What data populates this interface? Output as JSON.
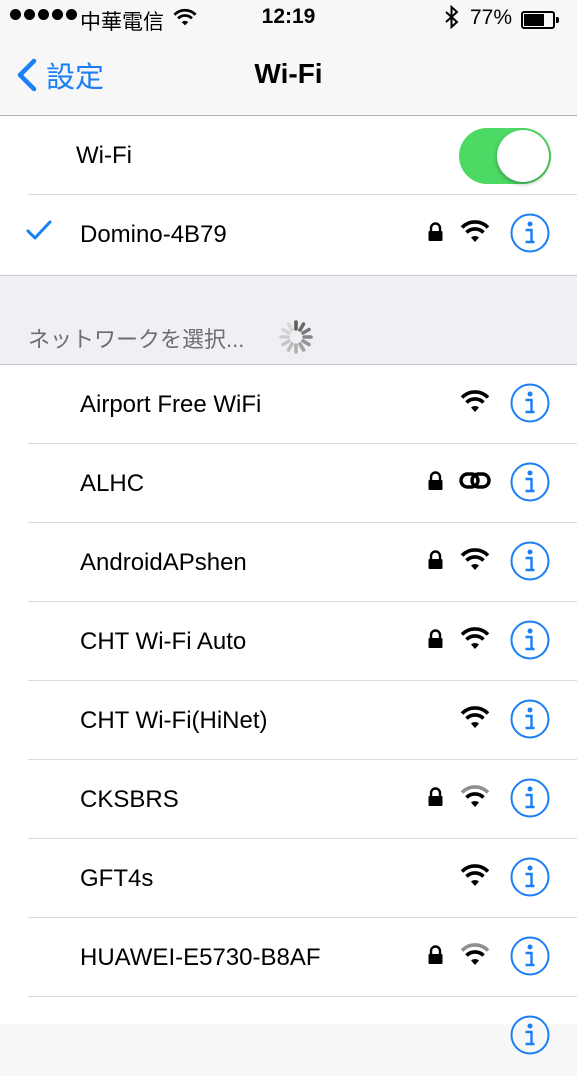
{
  "status_bar": {
    "carrier": "中華電信",
    "time": "12:19",
    "battery": "77%",
    "battery_level": 0.77
  },
  "nav": {
    "back_label": "設定",
    "title": "Wi-Fi"
  },
  "wifi_toggle": {
    "label": "Wi-Fi",
    "on": true
  },
  "connected_network": {
    "name": "Domino-4B79",
    "locked": true,
    "signal": "full"
  },
  "networks_header": "ネットワークを選択...",
  "networks": [
    {
      "name": "Airport Free WiFi",
      "locked": false,
      "signal": "full"
    },
    {
      "name": "ALHC",
      "locked": true,
      "signal": "link"
    },
    {
      "name": "AndroidAPshen",
      "locked": true,
      "signal": "full"
    },
    {
      "name": "CHT Wi-Fi Auto",
      "locked": true,
      "signal": "full"
    },
    {
      "name": "CHT Wi-Fi(HiNet)",
      "locked": false,
      "signal": "full"
    },
    {
      "name": "CKSBRS",
      "locked": true,
      "signal": "weak"
    },
    {
      "name": "GFT4s",
      "locked": false,
      "signal": "full"
    },
    {
      "name": "HUAWEI-E5730-B8AF",
      "locked": true,
      "signal": "weak"
    }
  ],
  "colors": {
    "accent": "#1a7ef5",
    "toggle_on": "#4cd964",
    "weak_signal": "#8e8e93"
  }
}
